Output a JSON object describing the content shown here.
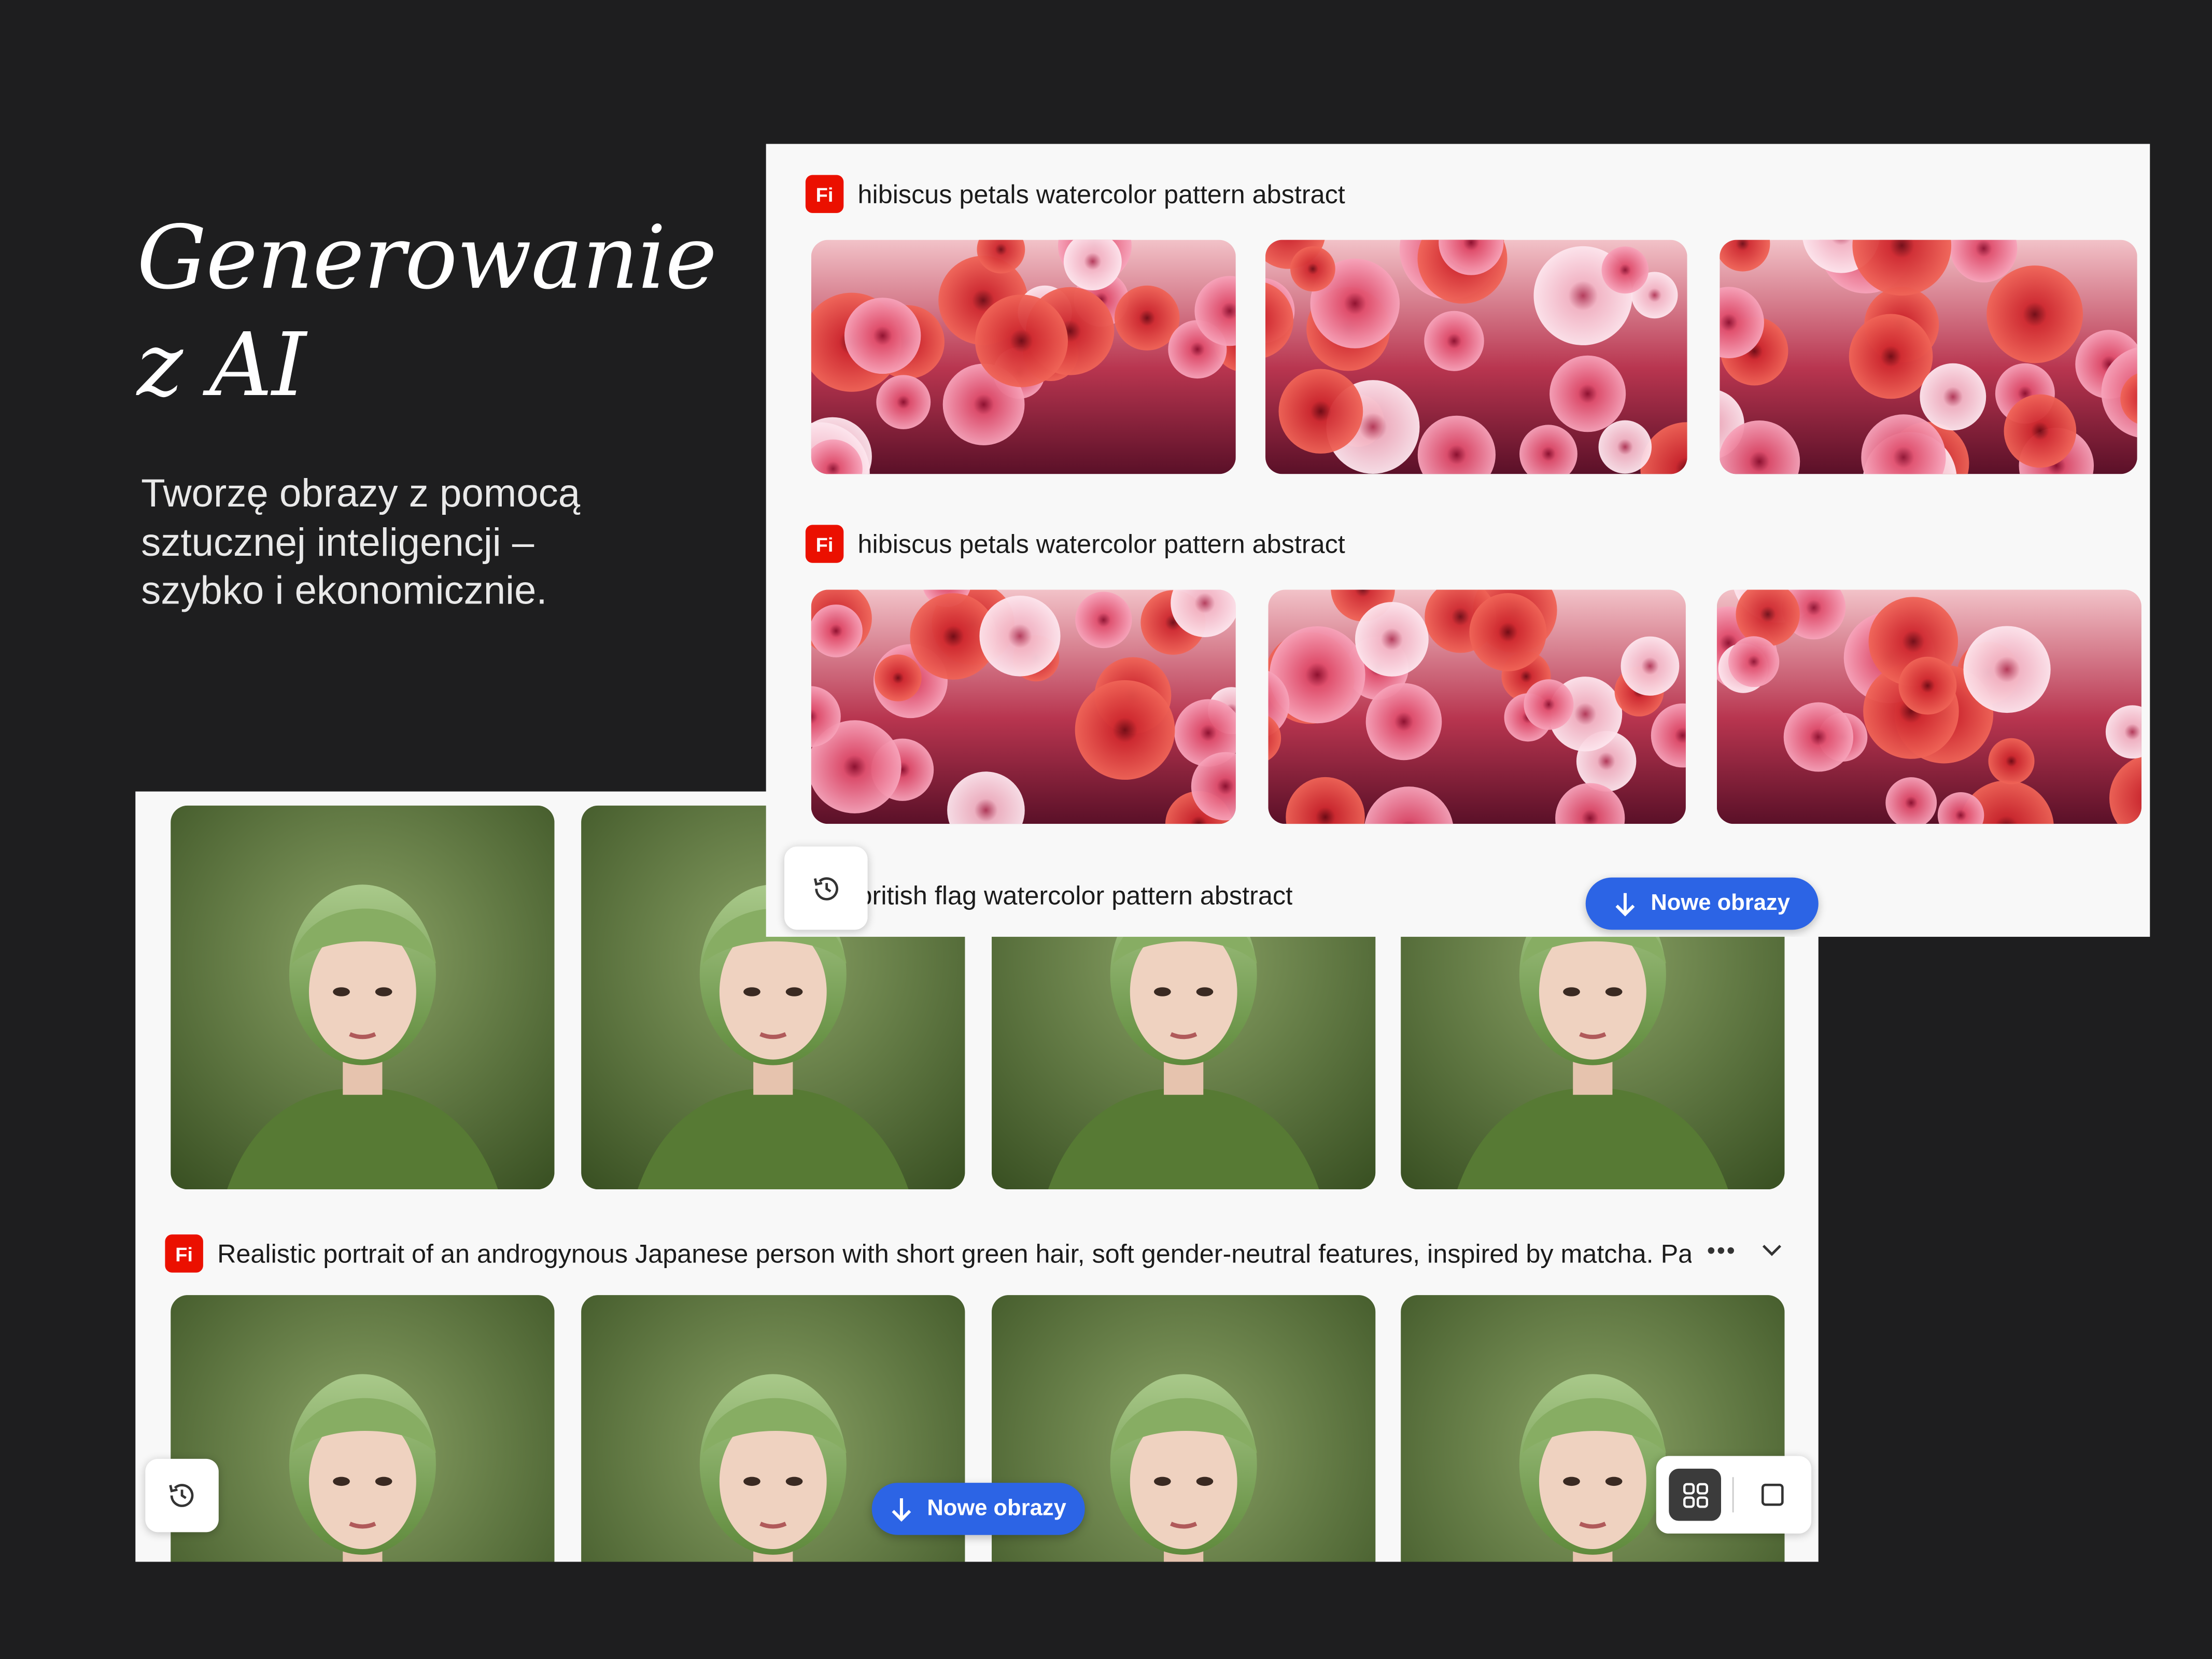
{
  "hero": {
    "title_line1": "Generowanie",
    "title_line2": "z AI",
    "subtitle_line1": "Tworzę obrazy z pomocą",
    "subtitle_line2": "sztucznej inteligencji –",
    "subtitle_line3": "szybko i ekonomicznie."
  },
  "flowers_panel": {
    "prompts": [
      "hibiscus petals watercolor pattern abstract",
      "hibiscus petals watercolor pattern abstract",
      "british flag watercolor pattern abstract"
    ],
    "new_images_label": "Nowe obrazy"
  },
  "portraits_panel": {
    "prompt": "Realistic portrait of an androgynous Japanese person with short green hair, soft gender-neutral features, inspired by matcha. Pale skin with a sligl",
    "more_label": "•••",
    "new_images_label": "Nowe obrazy"
  },
  "app": {
    "badge": "Fi"
  },
  "icons": {
    "badge": "firefly-icon",
    "history": "history-icon",
    "download": "arrow-down-icon",
    "grid": "grid-view-icon",
    "single": "single-view-icon",
    "chevron": "chevron-down-icon"
  },
  "colors": {
    "background": "#1e1e1f",
    "panel": "#f8f8f8",
    "accent": "#2c64e5",
    "badge": "#eb1000"
  }
}
